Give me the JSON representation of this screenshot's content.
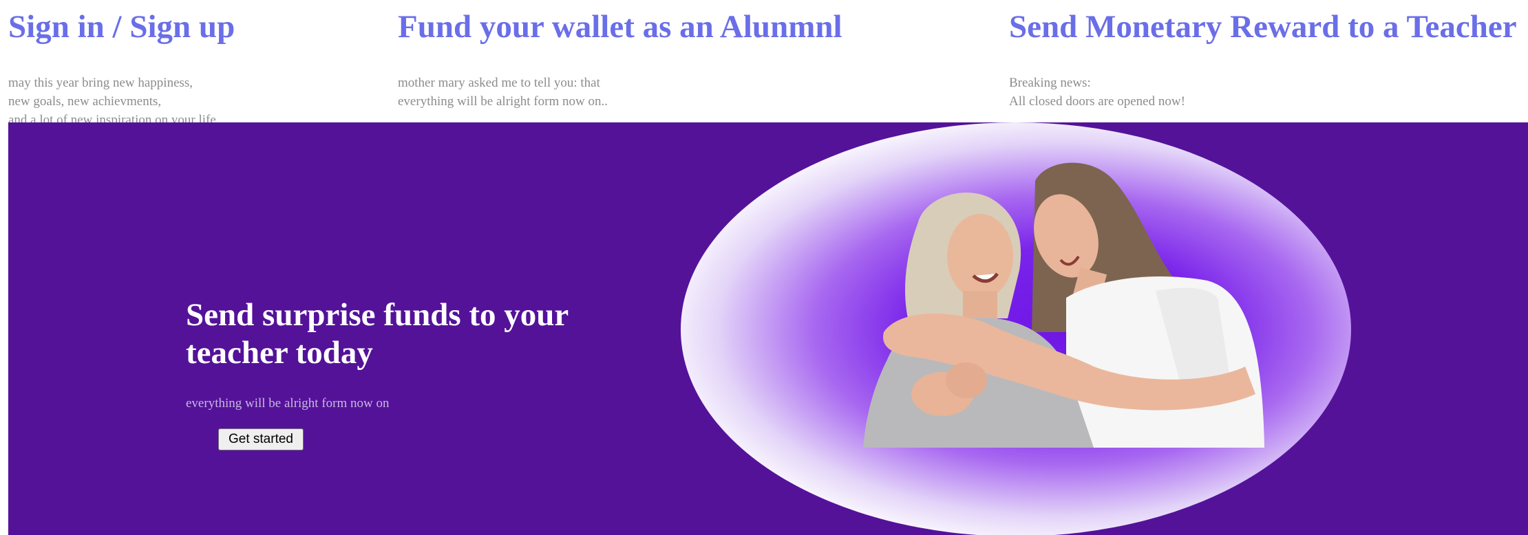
{
  "columns": [
    {
      "title": "Sign in / Sign up",
      "lines": [
        "may this year bring new happiness,",
        "new goals, new achievments,",
        "and a lot of new inspiration on your life."
      ]
    },
    {
      "title": "Fund your wallet as an Alunmnl",
      "lines": [
        "mother mary asked me to tell you: that",
        "everything will be alright form now on.."
      ]
    },
    {
      "title": "Send Monetary Reward to a Teacher",
      "lines": [
        "Breaking news:",
        "All closed doors are opened now!"
      ]
    }
  ],
  "hero": {
    "title": "Send surprise funds to your teacher today",
    "subtitle": "everything will be alright form now on",
    "button_label": "Get started",
    "image_icon": "hugging-women-photo"
  },
  "colors": {
    "heading": "#6a6ee8",
    "body_text": "#8c8c8c",
    "hero_bg": "#541299",
    "oval_glow": "#7a24ea"
  }
}
